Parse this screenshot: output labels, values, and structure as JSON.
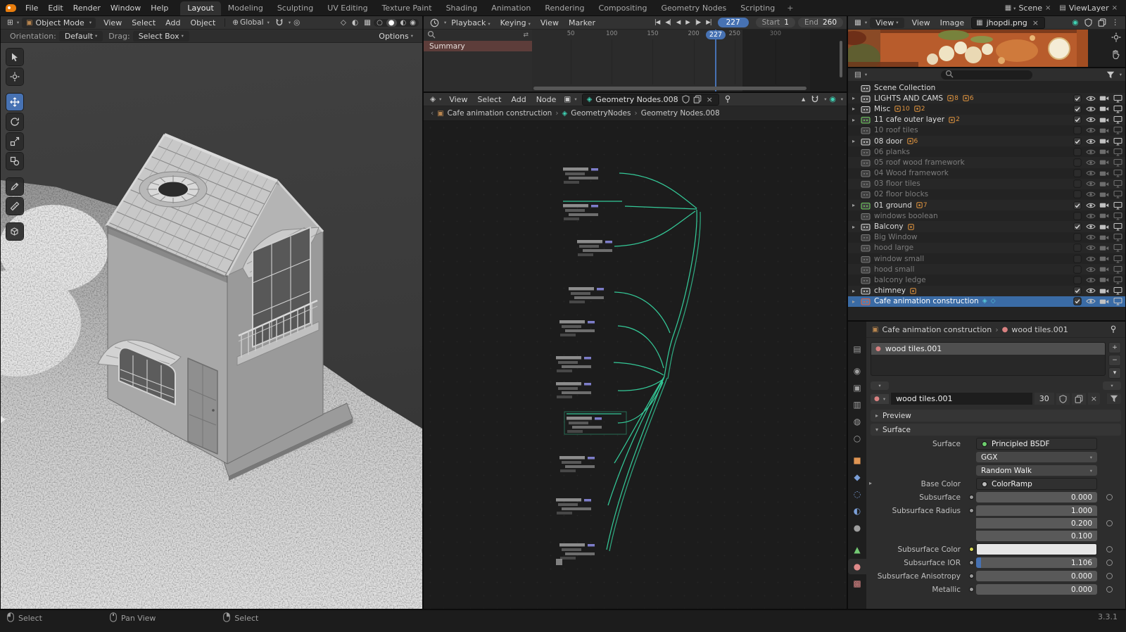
{
  "topbar": {
    "menus": [
      "File",
      "Edit",
      "Render",
      "Window",
      "Help"
    ],
    "workspaces": [
      "Layout",
      "Modeling",
      "Sculpting",
      "UV Editing",
      "Texture Paint",
      "Shading",
      "Animation",
      "Rendering",
      "Compositing",
      "Geometry Nodes",
      "Scripting"
    ],
    "active_workspace": "Layout",
    "add_workspace_label": "+",
    "scene_label": "Scene",
    "view_layer_label": "ViewLayer"
  },
  "viewport": {
    "header": {
      "mode": "Object Mode",
      "menus": [
        "View",
        "Select",
        "Add",
        "Object"
      ],
      "orientation": "Global"
    },
    "tool_settings": {
      "orientation_label": "Orientation:",
      "orientation_value": "Default",
      "drag_label": "Drag:",
      "drag_value": "Select Box",
      "options_label": "Options"
    }
  },
  "timeline": {
    "menus": [
      "Playback",
      "Keying",
      "View",
      "Marker"
    ],
    "current_frame": "227",
    "start_label": "Start",
    "start_value": "1",
    "end_label": "End",
    "end_value": "260",
    "channel": "Summary",
    "ruler_frames": [
      "50",
      "100",
      "150",
      "200",
      "250",
      "300"
    ]
  },
  "node_editor": {
    "menus": [
      "View",
      "Select",
      "Add",
      "Node"
    ],
    "datablock": "Geometry Nodes.008",
    "breadcrumb": [
      "Cafe animation construction",
      "GeometryNodes",
      "Geometry Nodes.008"
    ]
  },
  "image_editor": {
    "mode": "View",
    "menus": [
      "View",
      "Image"
    ],
    "image_name": "jhopdi.png"
  },
  "outliner": {
    "root_label": "Scene Collection",
    "items": [
      {
        "label": "LIGHTS AND CAMS",
        "enabled": true,
        "expand": true,
        "badges": [
          "8",
          "6"
        ]
      },
      {
        "label": "Misc",
        "enabled": true,
        "expand": true,
        "badges": [
          "10",
          "2"
        ]
      },
      {
        "label": "11 cafe outer layer",
        "enabled": true,
        "expand": true,
        "badges": [
          "2"
        ],
        "icon_color": "#6ec95d"
      },
      {
        "label": "10 roof tiles",
        "enabled": false
      },
      {
        "label": "08 door",
        "enabled": true,
        "expand": true,
        "badges": [
          "6"
        ]
      },
      {
        "label": "06 planks",
        "enabled": false
      },
      {
        "label": "05 roof wood framework",
        "enabled": false
      },
      {
        "label": "04 Wood framework",
        "enabled": false
      },
      {
        "label": "03 floor tiles",
        "enabled": false
      },
      {
        "label": "02 floor blocks",
        "enabled": false
      },
      {
        "label": "01 ground",
        "enabled": true,
        "expand": true,
        "badges": [
          "7"
        ],
        "icon_color": "#6ec95d"
      },
      {
        "label": "windows boolean",
        "enabled": false
      },
      {
        "label": "Balcony",
        "enabled": true,
        "expand": true,
        "badges": [
          ""
        ]
      },
      {
        "label": "Big Window",
        "enabled": false
      },
      {
        "label": "hood large",
        "enabled": false
      },
      {
        "label": "window small",
        "enabled": false
      },
      {
        "label": "hood small",
        "enabled": false
      },
      {
        "label": "balcony ledge",
        "enabled": false
      },
      {
        "label": "chimney",
        "enabled": true,
        "expand": true,
        "badges": [
          ""
        ]
      },
      {
        "label": "Cafe animation construction",
        "enabled": true,
        "expand": true,
        "selected": true,
        "icon_color": "#e0603a",
        "trail": true
      }
    ]
  },
  "properties": {
    "breadcrumb": [
      "Cafe animation construction",
      "wood tiles.001"
    ],
    "material_name": "wood tiles.001",
    "users_count": "30",
    "preview_label": "Preview",
    "surface_label": "Surface",
    "rows": [
      {
        "label": "Surface",
        "type": "node",
        "value": "Principled BSDF",
        "dot": "#6ecf6e"
      },
      {
        "label": "",
        "type": "dropdown",
        "value": "GGX"
      },
      {
        "label": "",
        "type": "dropdown",
        "value": "Random Walk"
      },
      {
        "label": "Base Color",
        "type": "node",
        "value": "ColorRamp",
        "dot": "#bdbdbd",
        "expander": true
      },
      {
        "label": "Subsurface",
        "type": "slider",
        "value": "0.000",
        "socket": "#9a9a9a",
        "decorator": true
      },
      {
        "label": "Subsurface Radius",
        "type": "slider",
        "value": "1.000",
        "socket": "#9a9a9a",
        "group": "top"
      },
      {
        "label": "",
        "type": "slider",
        "value": "0.200",
        "group": "mid",
        "decorator": true
      },
      {
        "label": "",
        "type": "slider",
        "value": "0.100",
        "group": "bot"
      },
      {
        "label": "Subsurface Color",
        "type": "color",
        "swatch": "#e6e6e6",
        "socket": "#d8d855",
        "decorator": true
      },
      {
        "label": "Subsurface IOR",
        "type": "slider",
        "value": "1.106",
        "socket": "#9a9a9a",
        "fill": "4%",
        "decorator": true
      },
      {
        "label": "Subsurface Anisotropy",
        "type": "slider",
        "value": "0.000",
        "socket": "#9a9a9a",
        "decorator": true
      },
      {
        "label": "Metallic",
        "type": "slider",
        "value": "0.000",
        "socket": "#9a9a9a",
        "decorator": true
      }
    ]
  },
  "statusbar": {
    "items": [
      {
        "button": "left",
        "label": "Select"
      },
      {
        "button": "middle",
        "label": "Pan View"
      },
      {
        "button": "right",
        "label": "Select"
      }
    ],
    "version": "3.3.1"
  }
}
